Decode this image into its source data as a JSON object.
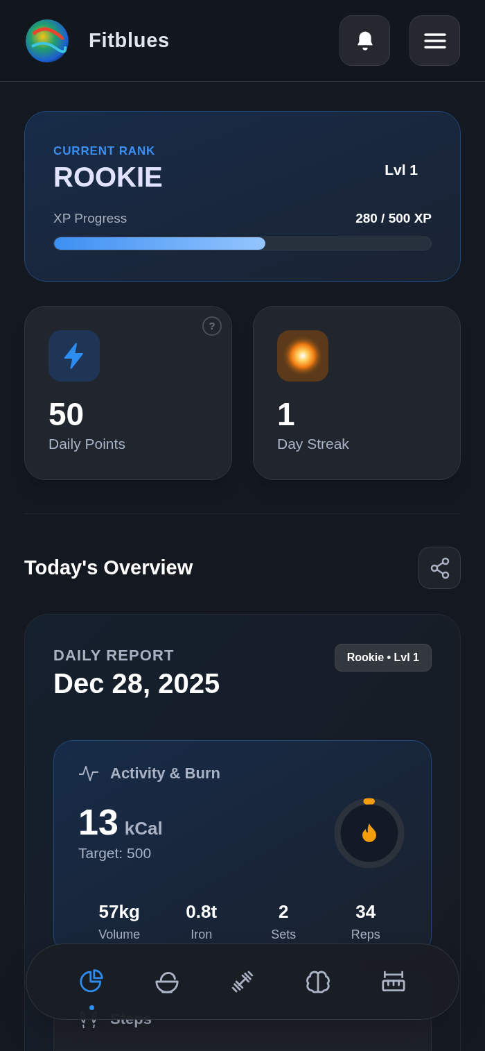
{
  "header": {
    "app_name": "Fitblues"
  },
  "rank_card": {
    "label": "CURRENT RANK",
    "rank": "ROOKIE",
    "level_text": "Lvl 1",
    "progress_label": "XP Progress",
    "progress_reading": "280 / 500 XP",
    "level": 0.56
  },
  "stats": [
    {
      "kind": "points",
      "value": "50",
      "label": "Daily Points",
      "help": "?"
    },
    {
      "kind": "streak",
      "value": "1",
      "label": "Day Streak"
    }
  ],
  "overview": {
    "title": "Today's Overview"
  },
  "report": {
    "label": "DAILY REPORT",
    "date": "Dec 28, 2025",
    "badge": "Rookie • Lvl 1",
    "activity": {
      "title": "Activity & Burn",
      "value": "13",
      "unit": "kCal",
      "target": "Target: 500",
      "level": 0.026,
      "metrics": [
        {
          "value": "57kg",
          "label": "Volume"
        },
        {
          "value": "0.8t",
          "label": "Iron"
        },
        {
          "value": "2",
          "label": "Sets"
        },
        {
          "value": "34",
          "label": "Reps"
        }
      ]
    },
    "next_section": {
      "title": "Steps"
    }
  },
  "nav": [
    {
      "kind": "overview",
      "selected": true
    },
    {
      "kind": "nutrition",
      "selected": false
    },
    {
      "kind": "workout",
      "selected": false
    },
    {
      "kind": "mind",
      "selected": false
    },
    {
      "kind": "measure",
      "selected": false
    }
  ]
}
